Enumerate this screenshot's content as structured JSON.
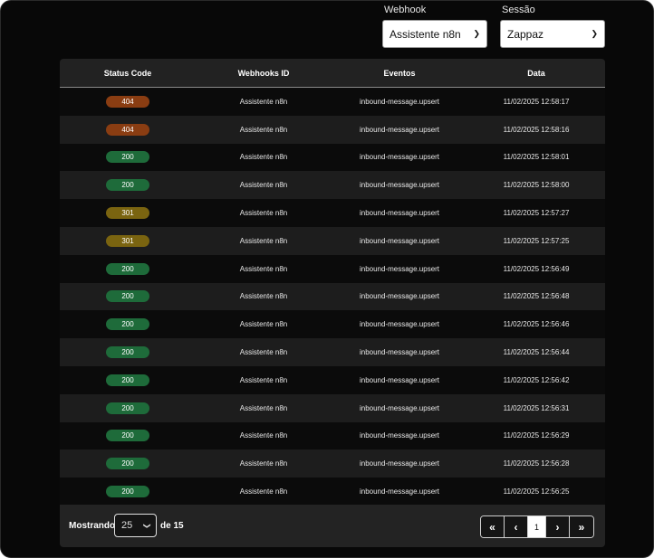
{
  "filters": {
    "webhook": {
      "label": "Webhook",
      "value": "Assistente n8n"
    },
    "sessao": {
      "label": "Sessão",
      "value": "Zappaz"
    }
  },
  "table": {
    "headers": [
      "Status Code",
      "Webhooks ID",
      "Eventos",
      "Data"
    ],
    "rows": [
      {
        "status": "404",
        "webhook": "Assistente n8n",
        "evento": "inbound-message.upsert",
        "data": "11/02/2025 12:58:17"
      },
      {
        "status": "404",
        "webhook": "Assistente n8n",
        "evento": "inbound-message.upsert",
        "data": "11/02/2025 12:58:16"
      },
      {
        "status": "200",
        "webhook": "Assistente n8n",
        "evento": "inbound-message.upsert",
        "data": "11/02/2025 12:58:01"
      },
      {
        "status": "200",
        "webhook": "Assistente n8n",
        "evento": "inbound-message.upsert",
        "data": "11/02/2025 12:58:00"
      },
      {
        "status": "301",
        "webhook": "Assistente n8n",
        "evento": "inbound-message.upsert",
        "data": "11/02/2025 12:57:27"
      },
      {
        "status": "301",
        "webhook": "Assistente n8n",
        "evento": "inbound-message.upsert",
        "data": "11/02/2025 12:57:25"
      },
      {
        "status": "200",
        "webhook": "Assistente n8n",
        "evento": "inbound-message.upsert",
        "data": "11/02/2025 12:56:49"
      },
      {
        "status": "200",
        "webhook": "Assistente n8n",
        "evento": "inbound-message.upsert",
        "data": "11/02/2025 12:56:48"
      },
      {
        "status": "200",
        "webhook": "Assistente n8n",
        "evento": "inbound-message.upsert",
        "data": "11/02/2025 12:56:46"
      },
      {
        "status": "200",
        "webhook": "Assistente n8n",
        "evento": "inbound-message.upsert",
        "data": "11/02/2025 12:56:44"
      },
      {
        "status": "200",
        "webhook": "Assistente n8n",
        "evento": "inbound-message.upsert",
        "data": "11/02/2025 12:56:42"
      },
      {
        "status": "200",
        "webhook": "Assistente n8n",
        "evento": "inbound-message.upsert",
        "data": "11/02/2025 12:56:31"
      },
      {
        "status": "200",
        "webhook": "Assistente n8n",
        "evento": "inbound-message.upsert",
        "data": "11/02/2025 12:56:29"
      },
      {
        "status": "200",
        "webhook": "Assistente n8n",
        "evento": "inbound-message.upsert",
        "data": "11/02/2025 12:56:28"
      },
      {
        "status": "200",
        "webhook": "Assistente n8n",
        "evento": "inbound-message.upsert",
        "data": "11/02/2025 12:56:25"
      }
    ]
  },
  "status_colors": {
    "404": "#8a3d12",
    "200": "#1e6b3a",
    "301": "#7a6410"
  },
  "footer": {
    "mostrando": "Mostrando",
    "page_size": "25",
    "total": "de 15",
    "current_page": "1",
    "first": "«",
    "prev": "‹",
    "next": "›",
    "last": "»"
  },
  "icons": {
    "select_chevron": "chevron-down-icon"
  }
}
